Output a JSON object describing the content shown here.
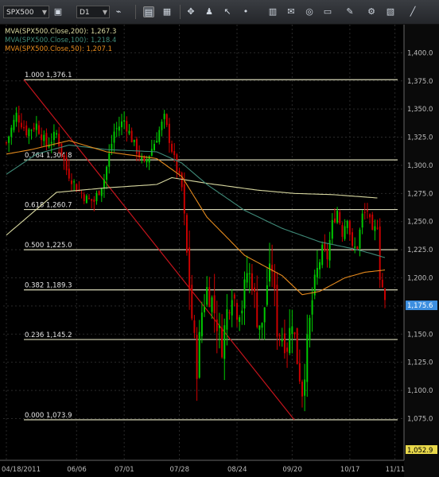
{
  "toolbar": {
    "symbol": "SPX500",
    "timeframe": "D1",
    "icons": [
      "chart-type-icon",
      "indicators-icon",
      "data-window-icon",
      "crosshair-icon",
      "objects-icon",
      "cursor-icon",
      "point-icon",
      "buy-sell-icon",
      "note-icon",
      "zoom-icon",
      "print-icon",
      "pencil-icon",
      "properties-icon",
      "screenshot-icon",
      "trendline-icon"
    ]
  },
  "colors": {
    "background": "#000000",
    "up": "#00cc00",
    "down": "#cc0000",
    "ma200": "#d8d8a0",
    "ma100": "#3f8a78",
    "ma50": "#e58a1d",
    "fib": "#d8d8b8",
    "trendline": "#c4141c"
  },
  "legend": [
    {
      "text": "MVA(SPX500.Close,200): 1,267.3",
      "color": "#d8d8a0"
    },
    {
      "text": "MVA(SPX500.Close,100): 1,218.4",
      "color": "#3f8a78"
    },
    {
      "text": "MVA(SPX500.Close,50): 1,207.1",
      "color": "#e58a1d"
    }
  ],
  "chart_data": {
    "type": "candlestick",
    "ylim": [
      1040,
      1425
    ],
    "y_ticks": [
      1400,
      1375,
      1350,
      1325,
      1300,
      1275,
      1250,
      1225,
      1200,
      1175,
      1150,
      1125,
      1100,
      1075
    ],
    "y_tick_labels": [
      "1,400.0",
      "1,375.0",
      "1,350.0",
      "1,325.0",
      "1,300.0",
      "1,275.0",
      "1,250.0",
      "1,225.0",
      "1,200.0",
      "1,175.0",
      "1,150.0",
      "1,125.0",
      "1,100.0",
      "1,075.0"
    ],
    "x_labels": [
      "04/18/2011",
      "06/06",
      "07/01",
      "07/28",
      "08/24",
      "09/20",
      "10/17",
      "11/11"
    ],
    "n_bars": 152,
    "x_label_bars": [
      0,
      28,
      47,
      69,
      92,
      114,
      137,
      155
    ],
    "current_price": "1,175.6",
    "current_value": 1175.6,
    "bottom_price": "1,052.9",
    "bottom_value": 1052.9,
    "fib_levels": [
      {
        "label": "1.000 1,376.1",
        "value": 1376.1
      },
      {
        "label": "0.764 1,304.8",
        "value": 1304.8
      },
      {
        "label": "0.618 1,260.7",
        "value": 1260.7
      },
      {
        "label": "0.500 1,225.0",
        "value": 1225.0
      },
      {
        "label": "0.382 1,189.3",
        "value": 1189.3
      },
      {
        "label": "0.236 1,145.2",
        "value": 1145.2
      },
      {
        "label": "0.000 1,073.9",
        "value": 1073.9
      }
    ],
    "trendline": {
      "from_value": 1376.1,
      "to_value": 1073.9
    },
    "close_path": [
      [
        0,
        1320
      ],
      [
        4,
        1345
      ],
      [
        8,
        1330
      ],
      [
        12,
        1336
      ],
      [
        16,
        1318
      ],
      [
        20,
        1328
      ],
      [
        24,
        1296
      ],
      [
        28,
        1280
      ],
      [
        32,
        1270
      ],
      [
        35,
        1268
      ],
      [
        39,
        1288
      ],
      [
        43,
        1330
      ],
      [
        47,
        1340
      ],
      [
        51,
        1318
      ],
      [
        55,
        1300
      ],
      [
        59,
        1320
      ],
      [
        63,
        1342
      ],
      [
        67,
        1305
      ],
      [
        70,
        1280
      ],
      [
        72,
        1220
      ],
      [
        74,
        1165
      ],
      [
        76,
        1120
      ],
      [
        78,
        1170
      ],
      [
        80,
        1190
      ],
      [
        82,
        1180
      ],
      [
        84,
        1160
      ],
      [
        86,
        1140
      ],
      [
        88,
        1170
      ],
      [
        90,
        1190
      ],
      [
        92,
        1172
      ],
      [
        94,
        1175
      ],
      [
        96,
        1205
      ],
      [
        98,
        1198
      ],
      [
        100,
        1165
      ],
      [
        102,
        1155
      ],
      [
        104,
        1195
      ],
      [
        106,
        1210
      ],
      [
        108,
        1155
      ],
      [
        110,
        1148
      ],
      [
        112,
        1140
      ],
      [
        114,
        1165
      ],
      [
        116,
        1128
      ],
      [
        118,
        1100
      ],
      [
        120,
        1140
      ],
      [
        122,
        1180
      ],
      [
        124,
        1205
      ],
      [
        126,
        1225
      ],
      [
        128,
        1218
      ],
      [
        130,
        1248
      ],
      [
        132,
        1260
      ],
      [
        134,
        1240
      ],
      [
        136,
        1255
      ],
      [
        138,
        1225
      ],
      [
        140,
        1228
      ],
      [
        142,
        1255
      ],
      [
        144,
        1260
      ],
      [
        146,
        1238
      ],
      [
        148,
        1248
      ],
      [
        149,
        1202
      ],
      [
        150,
        1192
      ],
      [
        151,
        1178
      ]
    ],
    "ma200_path": [
      [
        0,
        1238
      ],
      [
        20,
        1276
      ],
      [
        40,
        1280
      ],
      [
        60,
        1283
      ],
      [
        66,
        1289
      ],
      [
        80,
        1284
      ],
      [
        100,
        1278
      ],
      [
        115,
        1275
      ],
      [
        130,
        1274
      ],
      [
        148,
        1271
      ]
    ],
    "ma100_path": [
      [
        0,
        1292
      ],
      [
        12,
        1310
      ],
      [
        25,
        1318
      ],
      [
        40,
        1314
      ],
      [
        60,
        1312
      ],
      [
        70,
        1302
      ],
      [
        80,
        1283
      ],
      [
        95,
        1260
      ],
      [
        110,
        1244
      ],
      [
        125,
        1232
      ],
      [
        138,
        1226
      ],
      [
        145,
        1222
      ],
      [
        151,
        1218
      ]
    ],
    "ma50_path": [
      [
        0,
        1310
      ],
      [
        10,
        1314
      ],
      [
        25,
        1322
      ],
      [
        40,
        1312
      ],
      [
        60,
        1306
      ],
      [
        70,
        1290
      ],
      [
        80,
        1254
      ],
      [
        95,
        1220
      ],
      [
        110,
        1202
      ],
      [
        118,
        1185
      ],
      [
        125,
        1188
      ],
      [
        135,
        1200
      ],
      [
        143,
        1205
      ],
      [
        151,
        1207
      ]
    ]
  }
}
